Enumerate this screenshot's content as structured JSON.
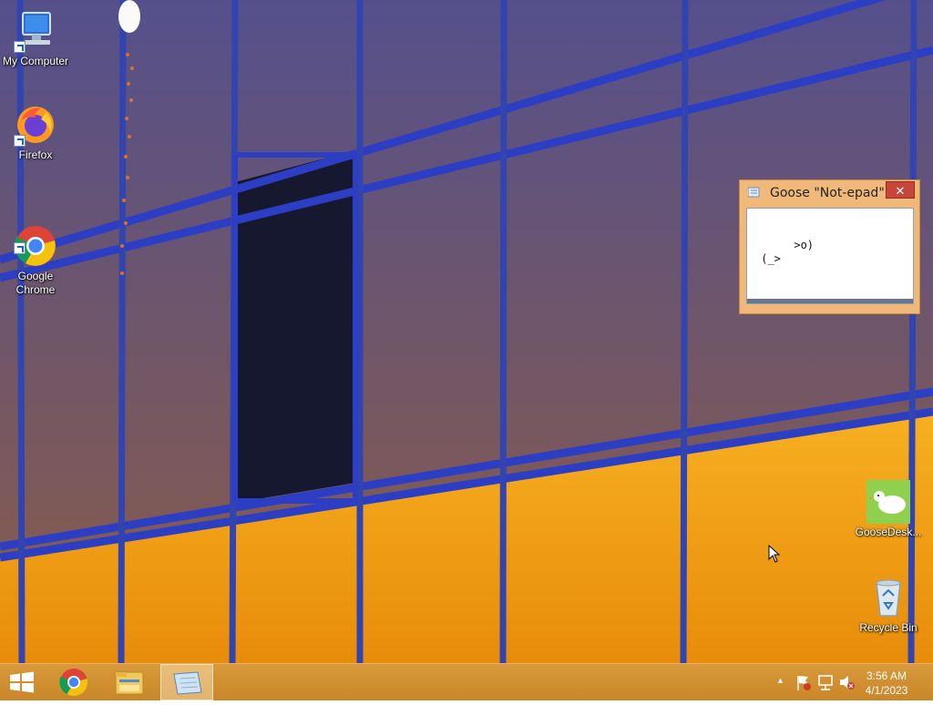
{
  "desktop_icons": [
    {
      "label": "My Computer",
      "icon": "computer-icon"
    },
    {
      "label": "Firefox",
      "icon": "firefox-icon"
    },
    {
      "label": "Google\nChrome",
      "icon": "chrome-icon"
    },
    {
      "label": "GooseDesk...",
      "icon": "goose-icon"
    },
    {
      "label": "Recycle Bin",
      "icon": "recycle-bin-icon"
    }
  ],
  "notepad": {
    "title": "Goose \"Not-epad\"",
    "close_label": "✕",
    "text": ">o)\n (_>"
  },
  "taskbar": {
    "start_icon": "windows-start-icon",
    "pinned": [
      {
        "name": "chrome-taskbar-icon"
      },
      {
        "name": "file-explorer-taskbar-icon"
      },
      {
        "name": "notepad-taskbar-icon",
        "active": true
      }
    ],
    "tray_arrow": "▲",
    "clock_time": "3:56 AM",
    "clock_date": "4/1/2023"
  },
  "colors": {
    "taskbar": "#c9862a",
    "window_frame": "#f1b979",
    "close_button": "#c7463a"
  }
}
